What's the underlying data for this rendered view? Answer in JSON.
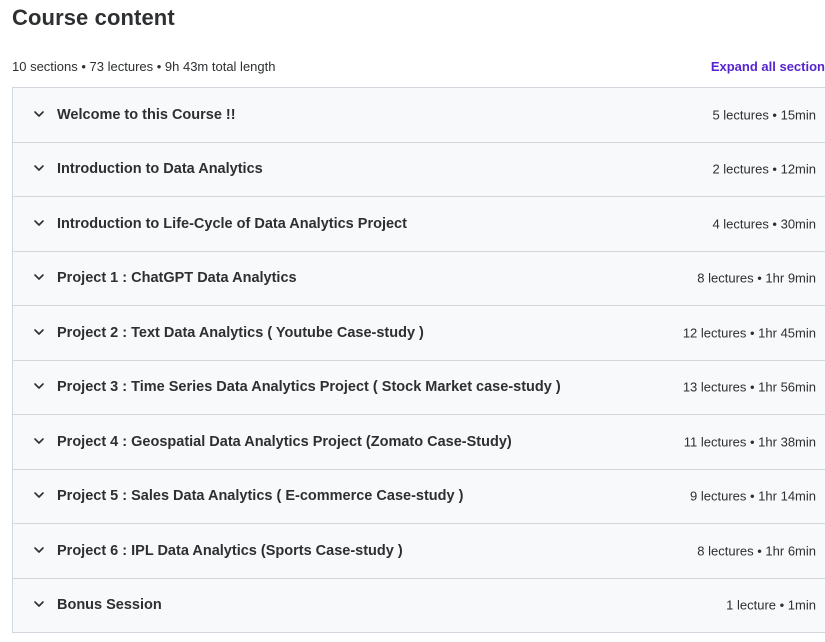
{
  "header": {
    "title": "Course content",
    "meta": "10 sections • 73 lectures • 9h 43m total length",
    "expand_all_label": "Expand all section"
  },
  "sections": [
    {
      "title": "Welcome to this Course !!",
      "info": "5 lectures • 15min"
    },
    {
      "title": "Introduction to Data Analytics",
      "info": "2 lectures • 12min"
    },
    {
      "title": "Introduction to Life-Cycle of Data Analytics Project",
      "info": "4 lectures • 30min"
    },
    {
      "title": "Project 1 : ChatGPT Data Analytics",
      "info": "8 lectures • 1hr 9min"
    },
    {
      "title": "Project 2 : Text Data Analytics ( Youtube Case-study )",
      "info": "12 lectures • 1hr 45min"
    },
    {
      "title": "Project 3 : Time Series Data Analytics Project ( Stock Market case-study )",
      "info": "13 lectures • 1hr 56min"
    },
    {
      "title": "Project 4 : Geospatial Data Analytics Project (Zomato Case-Study)",
      "info": "11 lectures • 1hr 38min"
    },
    {
      "title": "Project 5 : Sales Data Analytics ( E-commerce Case-study )",
      "info": "9 lectures • 1hr 14min"
    },
    {
      "title": "Project 6 : IPL Data Analytics (Sports Case-study )",
      "info": "8 lectures • 1hr 6min"
    },
    {
      "title": "Bonus Session",
      "info": "1 lecture • 1min"
    }
  ],
  "icons": {
    "chevron": "chevron-down-icon"
  },
  "colors": {
    "accent": "#5624d0",
    "text": "#2d2f31",
    "section_bg": "#f7f9fa",
    "border": "#d1d7dc"
  }
}
